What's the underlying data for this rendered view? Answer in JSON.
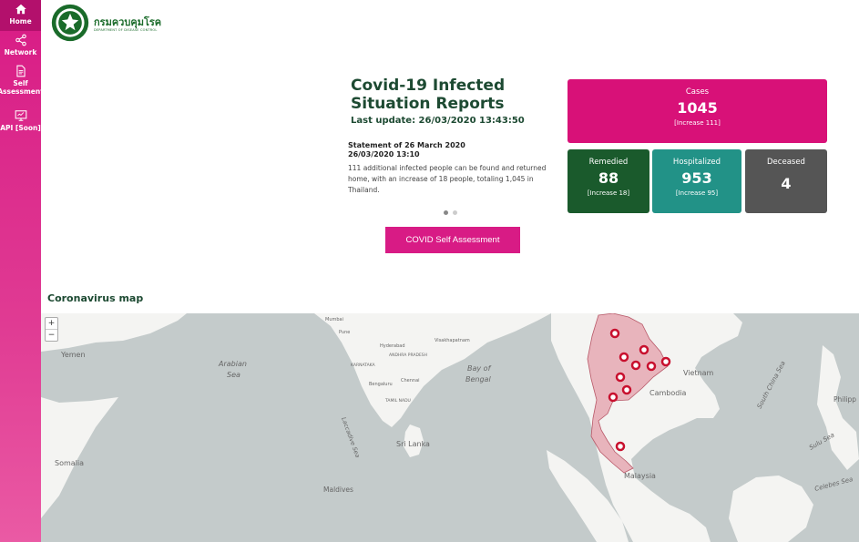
{
  "sidebar": {
    "items": [
      {
        "label": "Home",
        "icon": "home-icon"
      },
      {
        "label": "Network",
        "icon": "share-icon"
      },
      {
        "label": "Self Assessment",
        "icon": "document-icon"
      },
      {
        "label": "API [Soon]",
        "icon": "monitor-icon"
      }
    ]
  },
  "logo": {
    "thai": "กรมควบคุมโรค",
    "eng": "DEPARTMENT OF DISEASE CONTROL"
  },
  "report": {
    "title": "Covid-19 Infected Situation Reports",
    "last_update": "Last update: 26/03/2020 13:43:50",
    "statement_title": "Statement of 26 March 2020",
    "statement_date": "26/03/2020 13:10",
    "statement_body": "111 additional infected people can be found and returned home, with an increase of 18 people, totaling 1,045 in Thailand.",
    "assess_button": "COVID Self Assessment"
  },
  "stats": {
    "cases": {
      "label": "Cases",
      "value": "1045",
      "increase": "[Increase 111]"
    },
    "remedied": {
      "label": "Remedied",
      "value": "88",
      "increase": "[Increase 18]"
    },
    "hospitalized": {
      "label": "Hospitalized",
      "value": "953",
      "increase": "[Increase 95]"
    },
    "deceased": {
      "label": "Deceased",
      "value": "4"
    }
  },
  "map": {
    "title": "Coronavirus map",
    "zoom_in": "+",
    "zoom_out": "−",
    "labels": {
      "yemen": "Yemen",
      "somalia": "Somalia",
      "arabian_sea": "Arabian Sea",
      "bay_of_bengal": "Bay of Bengal",
      "sri_lanka": "Sri Lanka",
      "maldives": "Maldives",
      "laccadive_sea": "Laccadive Sea",
      "vietnam": "Vietnam",
      "cambodia": "Cambodia",
      "malaysia": "Malaysia",
      "south_china_sea": "South China Sea",
      "philippines": "Philipp",
      "sulu_sea": "Sulu Sea",
      "celebes_sea": "Celebes Sea",
      "mumbai": "Mumbai",
      "pune": "Pune",
      "hyderabad": "Hyderabad",
      "bengaluru": "Bengaluru",
      "chennai": "Chennai",
      "karnataka": "KARNATAKA",
      "tamil_nadu": "TAMIL NADU",
      "visakhapatnam": "Visakhapatnam",
      "andhra_pradesh": "ANDHRA PRADESH"
    },
    "colors": {
      "sea": "#c4cbcb",
      "land": "#f4f4f2",
      "thailand": "#e8b4bc",
      "marker": "#c8102e"
    }
  }
}
